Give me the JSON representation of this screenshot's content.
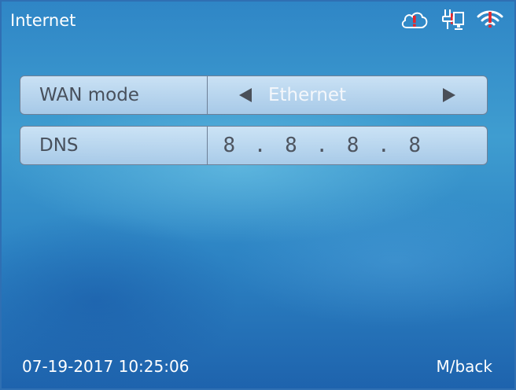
{
  "header": {
    "title": "Internet",
    "icons": [
      "cloud-alert-icon",
      "network-port-icon",
      "wifi-alert-icon"
    ]
  },
  "rows": [
    {
      "label": "WAN mode",
      "value": "Ethernet"
    },
    {
      "label": "DNS",
      "value": "8 . 8 . 8 . 8"
    }
  ],
  "footer": {
    "datetime": "07-19-2017 10:25:06",
    "back_label": "M/back"
  },
  "colors": {
    "alert": "#e8262b",
    "label_text": "#48505c",
    "panel_border": "#6d7f96"
  }
}
